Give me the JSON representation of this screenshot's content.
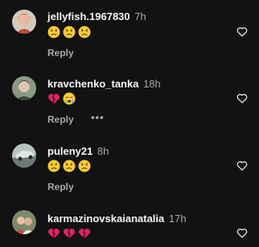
{
  "comments": [
    {
      "username": "jellyfish.1967830",
      "time": "7h",
      "reactions": [
        "sad-face",
        "sad-face",
        "sad-face"
      ],
      "reply": "Reply",
      "more": ""
    },
    {
      "username": "kravchenko_tanka",
      "time": "18h",
      "reactions": [
        "broken-heart",
        "crying-face"
      ],
      "reply": "Reply",
      "more": "•••"
    },
    {
      "username": "puleny21",
      "time": "8h",
      "reactions": [
        "sad-face",
        "sad-face",
        "sad-face"
      ],
      "reply": "Reply",
      "more": ""
    },
    {
      "username": "karmazinovskaianatalia",
      "time": "17h",
      "reactions": [
        "broken-heart",
        "broken-heart",
        "broken-heart"
      ],
      "reply": "",
      "more": ""
    }
  ],
  "colors": {
    "background": "#121212",
    "text": "#f5f5f5",
    "muted": "#a8a8a8",
    "emoji_yellow": "#ffcc33",
    "heart_red": "#e0245e"
  }
}
